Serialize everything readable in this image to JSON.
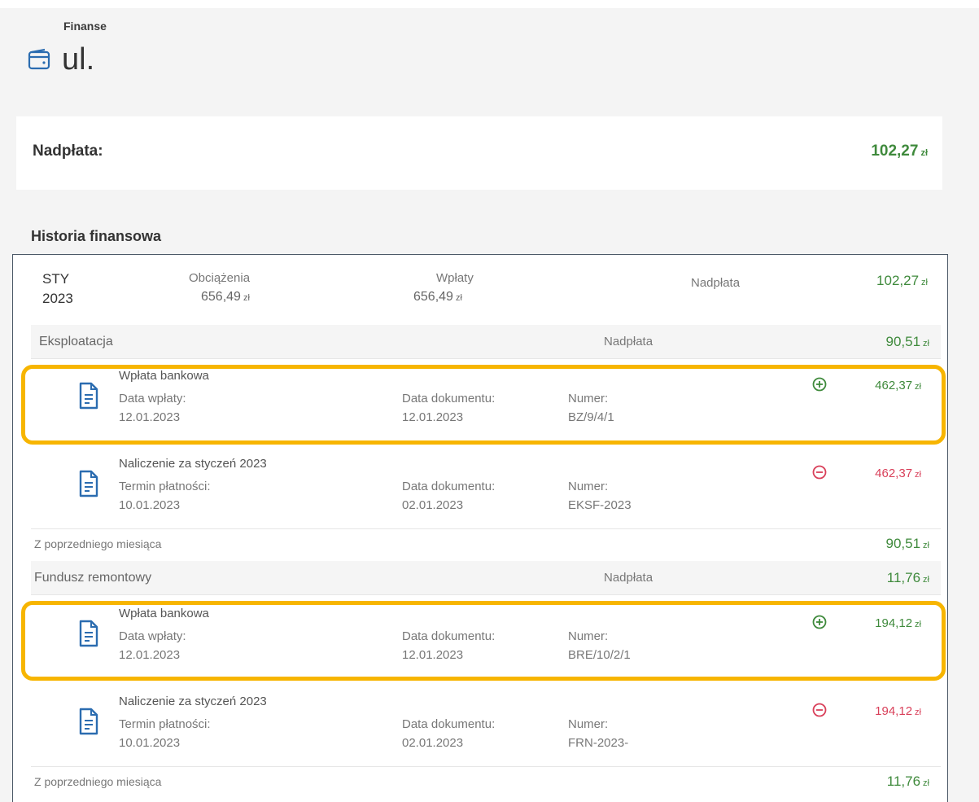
{
  "header": {
    "section": "Finanse",
    "title": "ul."
  },
  "balance": {
    "label": "Nadpłata:",
    "value": "102,27",
    "currency": "zł"
  },
  "history": {
    "heading": "Historia finansowa",
    "month": {
      "month": "STY",
      "year": "2023",
      "charges_label": "Obciążenia",
      "charges_value": "656,49",
      "payments_label": "Wpłaty",
      "payments_value": "656,49",
      "status_label": "Nadpłata",
      "status_value": "102,27"
    },
    "categories": [
      {
        "name": "Eksploatacja",
        "status_label": "Nadpłata",
        "status_value": "90,51",
        "transactions": [
          {
            "title": "Wpłata bankowa",
            "date_label": "Data wpłaty:",
            "date": "12.01.2023",
            "doc_date_label": "Data dokumentu:",
            "doc_date": "12.01.2023",
            "number_label": "Numer:",
            "number": "BZ/9/4/1",
            "sign": "plus",
            "amount": "462,37"
          },
          {
            "title": "Naliczenie za styczeń 2023",
            "date_label": "Termin płatności:",
            "date": "10.01.2023",
            "doc_date_label": "Data dokumentu:",
            "doc_date": "02.01.2023",
            "number_label": "Numer:",
            "number": "EKSF-2023",
            "sign": "minus",
            "amount": "462,37"
          }
        ],
        "previous_label": "Z poprzedniego miesiąca",
        "previous_value": "90,51"
      },
      {
        "name": "Fundusz remontowy",
        "status_label": "Nadpłata",
        "status_value": "11,76",
        "transactions": [
          {
            "title": "Wpłata bankowa",
            "date_label": "Data wpłaty:",
            "date": "12.01.2023",
            "doc_date_label": "Data dokumentu:",
            "doc_date": "12.01.2023",
            "number_label": "Numer:",
            "number": "BRE/10/2/1",
            "sign": "plus",
            "amount": "194,12"
          },
          {
            "title": "Naliczenie za styczeń 2023",
            "date_label": "Termin płatności:",
            "date": "10.01.2023",
            "doc_date_label": "Data dokumentu:",
            "doc_date": "02.01.2023",
            "number_label": "Numer:",
            "number": "FRN-2023-",
            "sign": "minus",
            "amount": "194,12"
          }
        ],
        "previous_label": "Z poprzedniego miesiąca",
        "previous_value": "11,76"
      }
    ]
  },
  "currency": "zł",
  "colors": {
    "positive": "#3f8a3c",
    "negative": "#d9405a",
    "highlight": "#f7b500",
    "icon": "#2b6cb0"
  },
  "icons": {
    "wallet": "wallet-icon",
    "document": "document-icon",
    "plus": "plus-circle-icon",
    "minus": "minus-circle-icon"
  }
}
